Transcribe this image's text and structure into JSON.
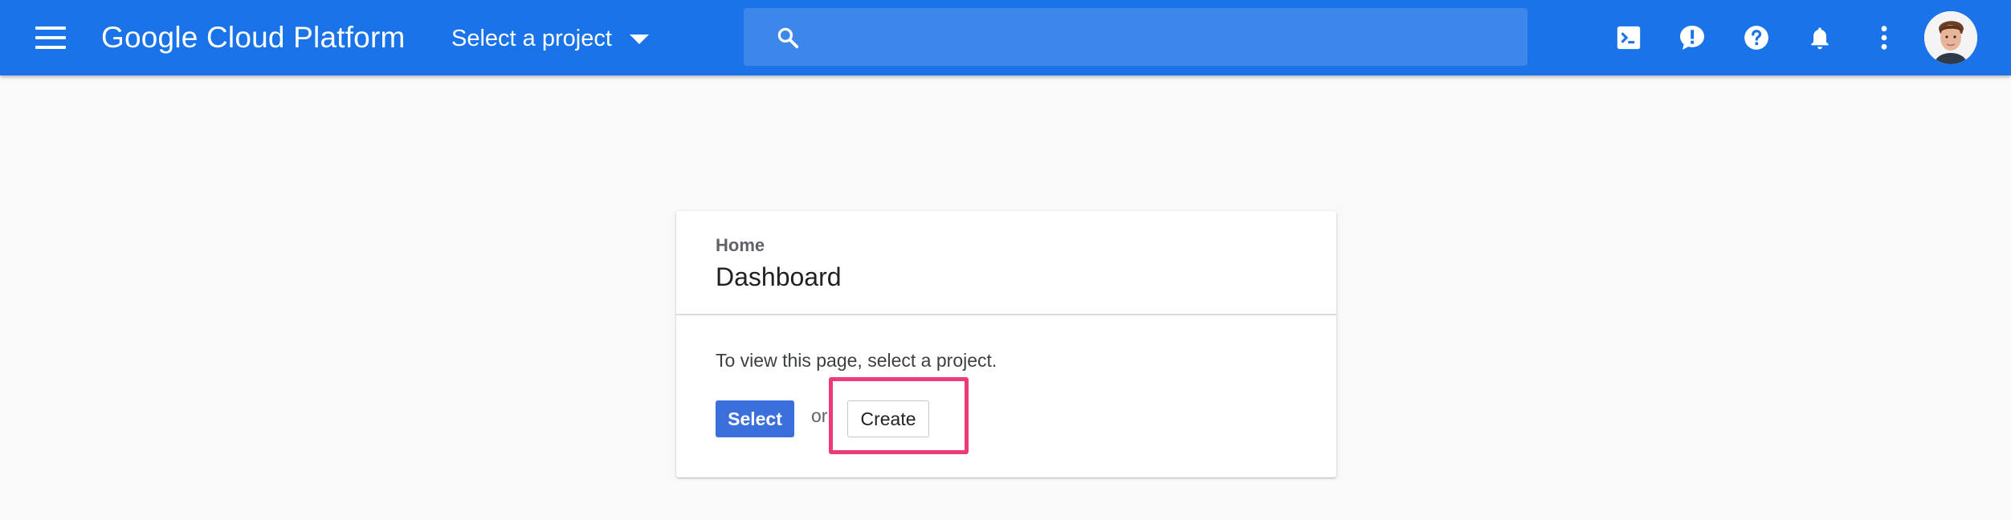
{
  "appbar": {
    "menu_icon": "hamburger-menu-icon",
    "logo": "Google Cloud Platform",
    "project_selector": {
      "label": "Select a project",
      "icon": "caret-down-icon"
    },
    "search": {
      "placeholder": "",
      "icon": "search-icon"
    },
    "actions": [
      {
        "name": "cloud-shell",
        "icon": "terminal-icon"
      },
      {
        "name": "feedback",
        "icon": "feedback-exclamation-icon"
      },
      {
        "name": "help",
        "icon": "help-question-icon"
      },
      {
        "name": "notifications",
        "icon": "bell-icon"
      },
      {
        "name": "more",
        "icon": "more-vertical-icon"
      }
    ],
    "account": {
      "icon": "user-avatar"
    }
  },
  "card": {
    "breadcrumb": "Home",
    "title": "Dashboard",
    "message": "To view this page, select a project.",
    "select_label": "Select",
    "or_text": "or",
    "create_label": "Create"
  },
  "colors": {
    "appbar": "#1a73e8",
    "search_bg": "#3d86ea",
    "primary_button": "#3b6fdc",
    "highlight": "#ec3a7a",
    "page_bg": "#f9f9f9"
  }
}
